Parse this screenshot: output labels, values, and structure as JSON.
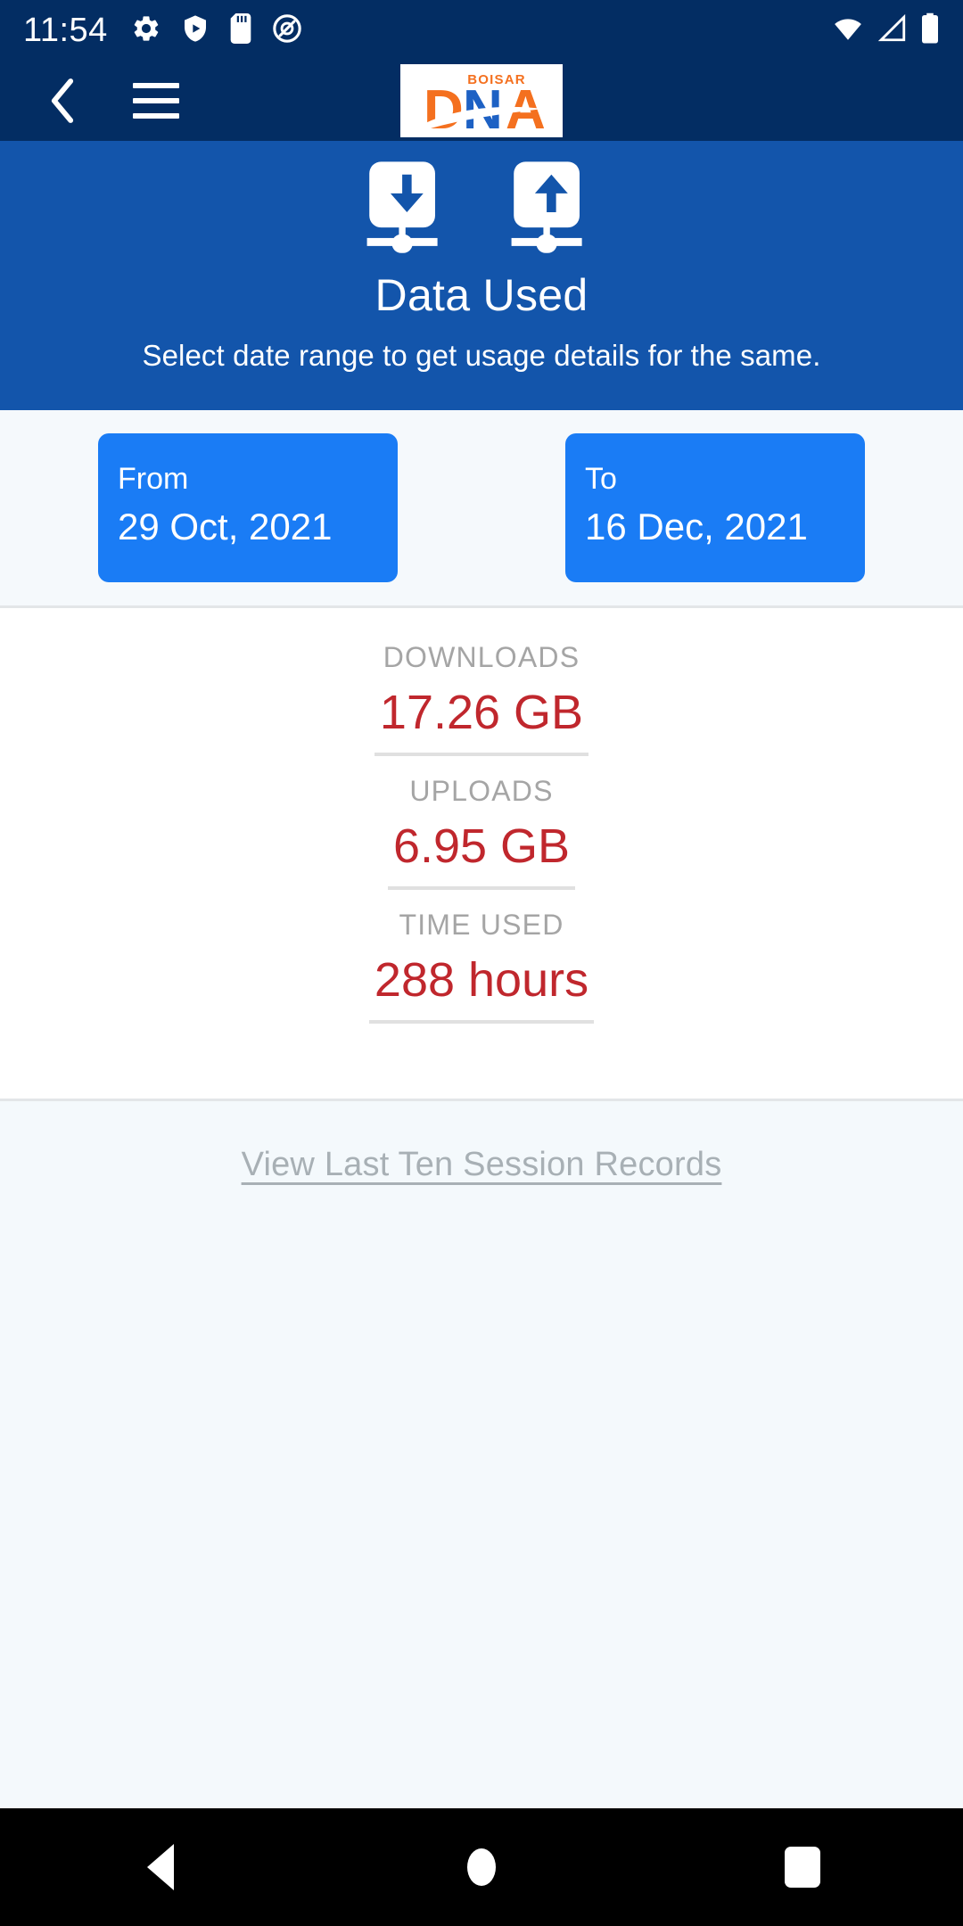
{
  "status_bar": {
    "time": "11:54",
    "left_icons": [
      "gear-icon",
      "play-shield-icon",
      "sd-card-icon",
      "do-not-disturb-icon"
    ],
    "right_icons": [
      "wifi-icon",
      "signal-icon",
      "battery-icon"
    ]
  },
  "app_bar": {
    "back_icon": "chevron-left-icon",
    "menu_icon": "hamburger-menu-icon",
    "logo": {
      "top_text": "BOISAR",
      "letters": "DNA",
      "letter_d": "D",
      "letter_n": "N",
      "letter_a": "A",
      "colors": {
        "orange": "#f4701f",
        "blue": "#1d61c4",
        "background": "#ffffff"
      }
    }
  },
  "banner": {
    "download_icon": "download-network-icon",
    "upload_icon": "upload-network-icon",
    "title": "Data Used",
    "subtitle": "Select date range to get usage details for the same.",
    "background_color": "#1355ab"
  },
  "date_range": {
    "from": {
      "label": "From",
      "value": "29 Oct, 2021"
    },
    "to": {
      "label": "To",
      "value": "16 Dec, 2021"
    },
    "button_color": "#1a7cf5"
  },
  "stats": {
    "value_color": "#c0272d",
    "label_color": "#a5a5a5",
    "items": [
      {
        "label": "DOWNLOADS",
        "value": "17.26 GB"
      },
      {
        "label": "UPLOADS",
        "value": "6.95 GB"
      },
      {
        "label": "TIME USED",
        "value": "288 hours"
      }
    ]
  },
  "footer": {
    "records_link": "View Last Ten Session Records"
  },
  "nav_bar": {
    "back": "nav-back-icon",
    "home": "nav-home-icon",
    "recents": "nav-recents-icon"
  }
}
